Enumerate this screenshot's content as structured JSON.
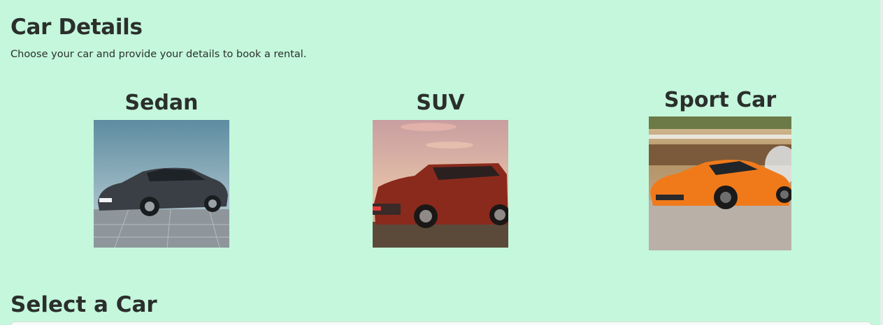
{
  "header": {
    "title": "Car Details",
    "subtitle": "Choose your car and provide your details to book a rental."
  },
  "cars": [
    {
      "label": "Sedan",
      "image_icon": "sedan-photo",
      "color": "#3a3f45"
    },
    {
      "label": "SUV",
      "image_icon": "suv-photo",
      "color": "#8a2a1c"
    },
    {
      "label": "Sport Car",
      "image_icon": "sport-car-photo",
      "color": "#f07a1a"
    }
  ],
  "select": {
    "heading": "Select a Car"
  }
}
